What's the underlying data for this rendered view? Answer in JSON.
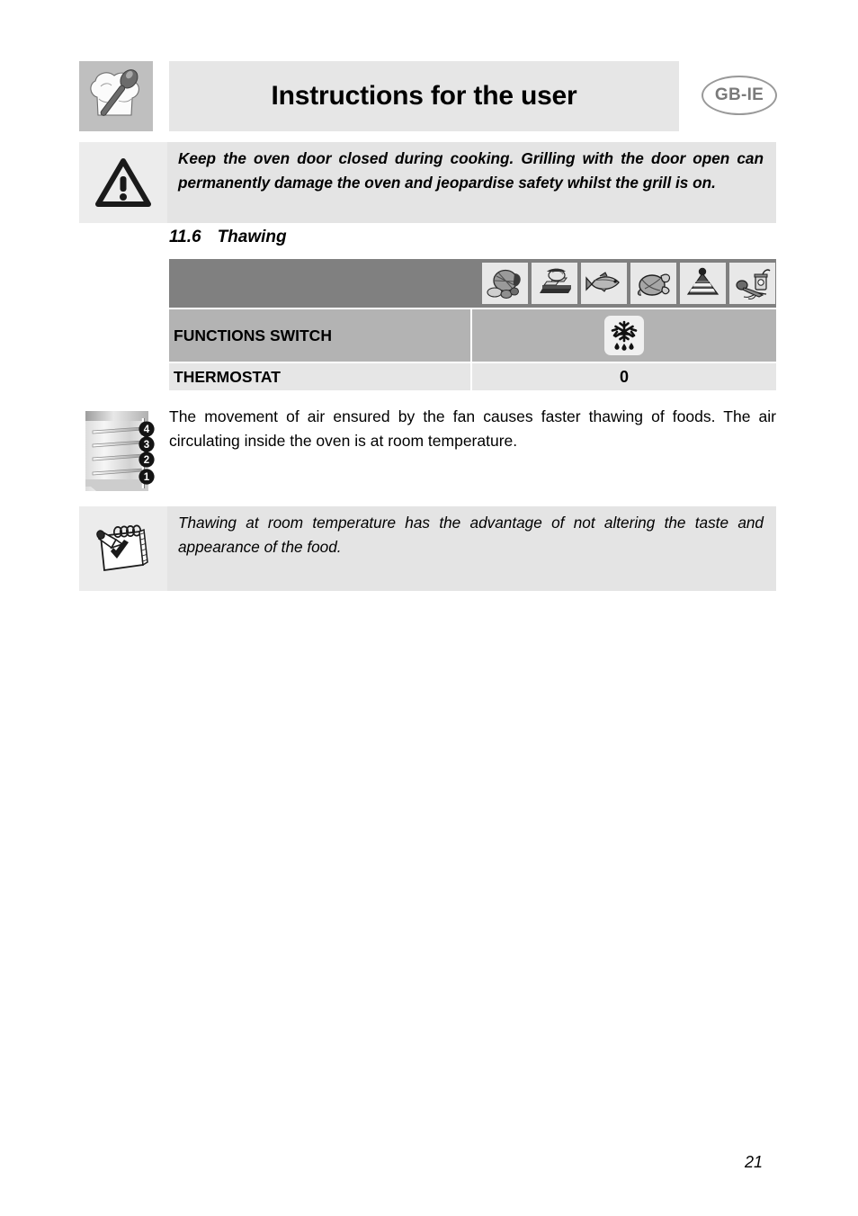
{
  "header": {
    "icon": "chef-hat-spoon-icon",
    "title": "Instructions for the user",
    "language_badge": "GB-IE"
  },
  "warning": {
    "icon": "warning-triangle-icon",
    "text": "Keep the oven door closed during cooking. Grilling with the door open can permanently damage the oven and jeopardise safety whilst the grill is on."
  },
  "section": {
    "number": "11.6",
    "title": "Thawing"
  },
  "table": {
    "food_icons": [
      "roast-ham-icon",
      "toast-grill-icon",
      "fish-icon",
      "roast-chicken-icon",
      "layer-cake-icon",
      "preserves-vegetables-icon"
    ],
    "rows": [
      {
        "label": "FUNCTIONS SWITCH",
        "value": "",
        "value_icon": "snowflake-defrost-icon"
      },
      {
        "label": "THERMOSTAT",
        "value": "0",
        "value_icon": ""
      }
    ]
  },
  "oven_diagram": {
    "icon": "oven-shelf-levels-icon",
    "shelf_levels": [
      "4",
      "3",
      "2",
      "1"
    ]
  },
  "body": {
    "paragraph": "The movement of air ensured by the fan causes faster thawing of foods. The air circulating inside the oven is at room temperature."
  },
  "note": {
    "icon": "notepad-pencil-icon",
    "text": "Thawing at room temperature has the advantage of not altering the taste and appearance of the food."
  },
  "footer": {
    "page_number": "21"
  },
  "colors": {
    "header_band": "#e6e6e6",
    "header_icon_band": "#bfbfbf",
    "table_header_band": "#808080",
    "table_mid_band": "#b3b3b3",
    "table_light_band": "#e6e6e6",
    "callout_band": "#e4e4e4",
    "badge_outline": "#999999"
  }
}
